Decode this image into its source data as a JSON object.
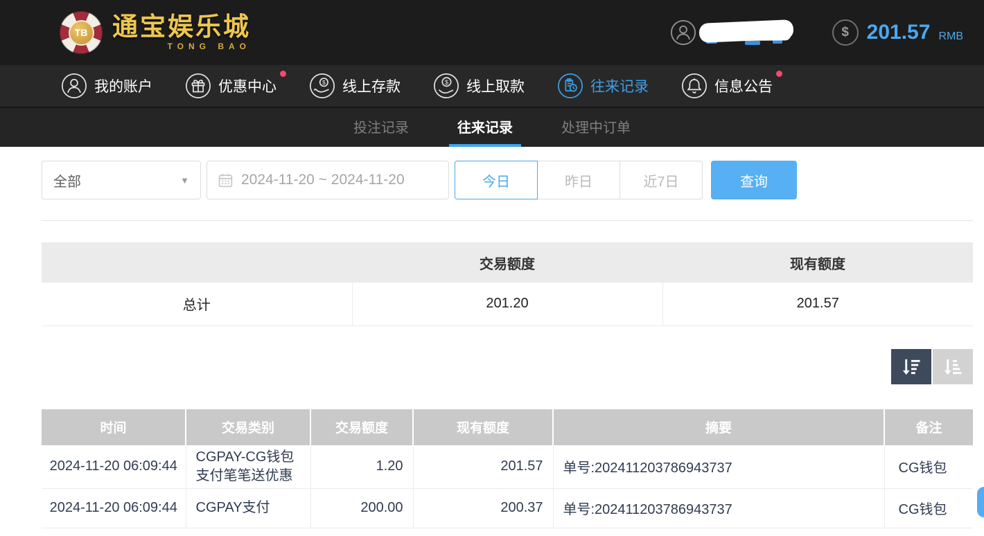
{
  "brand": {
    "chip_text": "TB",
    "title": "通宝娱乐城",
    "subtitle": "TONG BAO"
  },
  "header": {
    "balance": "201.57",
    "currency": "RMB"
  },
  "nav": {
    "items": [
      {
        "label": "我的账户",
        "icon": "user-circle",
        "active": false,
        "badge": false
      },
      {
        "label": "优惠中心",
        "icon": "gift",
        "active": false,
        "badge": true
      },
      {
        "label": "线上存款",
        "icon": "hand-coin",
        "active": false,
        "badge": false
      },
      {
        "label": "线上取款",
        "icon": "hand-dollar",
        "active": false,
        "badge": false
      },
      {
        "label": "往来记录",
        "icon": "clipboard-clock",
        "active": true,
        "badge": false
      },
      {
        "label": "信息公告",
        "icon": "bell",
        "active": false,
        "badge": true
      }
    ]
  },
  "tabs": {
    "items": [
      {
        "label": "投注记录",
        "active": false
      },
      {
        "label": "往来记录",
        "active": true
      },
      {
        "label": "处理中订单",
        "active": false
      }
    ]
  },
  "filters": {
    "type_select": {
      "value": "全部"
    },
    "date_range": "2024-11-20 ~ 2024-11-20",
    "quick": {
      "today": "今日",
      "yesterday": "昨日",
      "last7": "近7日",
      "active": "今日"
    },
    "query_label": "查询"
  },
  "summary": {
    "columns": {
      "c1": "",
      "c2": "交易额度",
      "c3": "现有额度"
    },
    "total_label": "总计",
    "trade_total": "201.20",
    "balance_total": "201.57"
  },
  "records": {
    "columns": [
      "时间",
      "交易类别",
      "交易额度",
      "现有额度",
      "摘要",
      "备注"
    ],
    "rows": [
      {
        "time": "2024-11-20 06:09:44",
        "type": "CGPAY-CG钱包支付笔笔送优惠",
        "amount": "1.20",
        "balance": "201.57",
        "summary": "单号:202411203786943737",
        "note": "CG钱包"
      },
      {
        "time": "2024-11-20 06:09:44",
        "type": "CGPAY支付",
        "amount": "200.00",
        "balance": "200.37",
        "summary": "单号:202411203786943737",
        "note": "CG钱包"
      }
    ]
  },
  "icons": {
    "dollar": "$",
    "chevron_down": "▼",
    "user_avatar": "user-circle",
    "calendar": "calendar",
    "sort_descending": "arrow-down-bars-desc",
    "sort_ascending": "arrow-down-bars-asc",
    "badge": "red-dot"
  },
  "colors": {
    "accent_blue": "#3d9fe6",
    "button_blue": "#57b0f3",
    "badge_red": "#f24a6e",
    "gold": "#eec64f",
    "header_bg": "#1c1c1c",
    "nav_bg": "#282828",
    "table_header_gray": "#c9c9c9",
    "sort_active_bg": "#3d4a5c"
  }
}
